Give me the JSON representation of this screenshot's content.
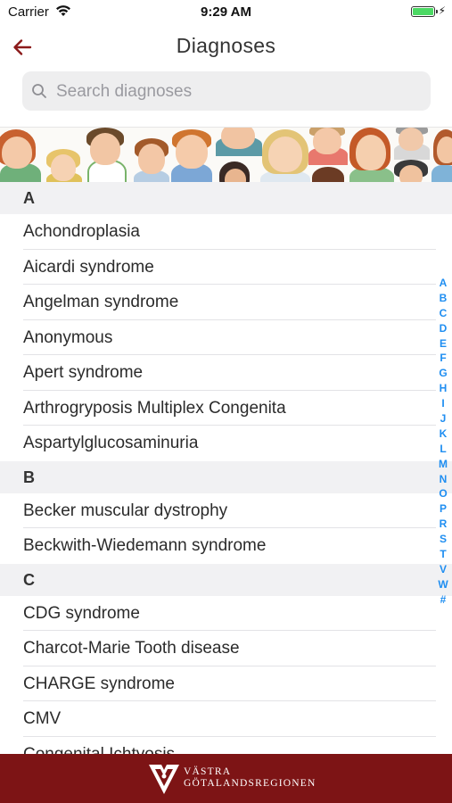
{
  "status_bar": {
    "carrier": "Carrier",
    "time": "9:29 AM",
    "battery_color": "#4cd964"
  },
  "nav": {
    "title": "Diagnoses",
    "back_icon": "arrow-left-icon",
    "accent_color": "#8b1a1a"
  },
  "search": {
    "placeholder": "Search diagnoses",
    "value": ""
  },
  "sections": [
    {
      "letter": "A",
      "items": [
        "Achondroplasia",
        "Aicardi syndrome",
        "Angelman syndrome",
        "Anonymous",
        "Apert syndrome",
        "Arthrogryposis Multiplex Congenita",
        "Aspartylglucosaminuria"
      ]
    },
    {
      "letter": "B",
      "items": [
        "Becker muscular dystrophy",
        "Beckwith-Wiedemann syndrome"
      ]
    },
    {
      "letter": "C",
      "items": [
        "CDG syndrome",
        "Charcot-Marie Tooth disease",
        "CHARGE syndrome",
        "CMV",
        "Congenital Ichtyosis"
      ]
    }
  ],
  "index_letters": [
    "A",
    "B",
    "C",
    "D",
    "E",
    "F",
    "G",
    "H",
    "I",
    "J",
    "K",
    "L",
    "M",
    "N",
    "O",
    "P",
    "R",
    "S",
    "T",
    "V",
    "W",
    "#"
  ],
  "index_color": "#1f8ef1",
  "footer": {
    "logo_line1": "VÄSTRA",
    "logo_line2": "GÖTALANDSREGIONEN",
    "background": "#7d1415"
  }
}
